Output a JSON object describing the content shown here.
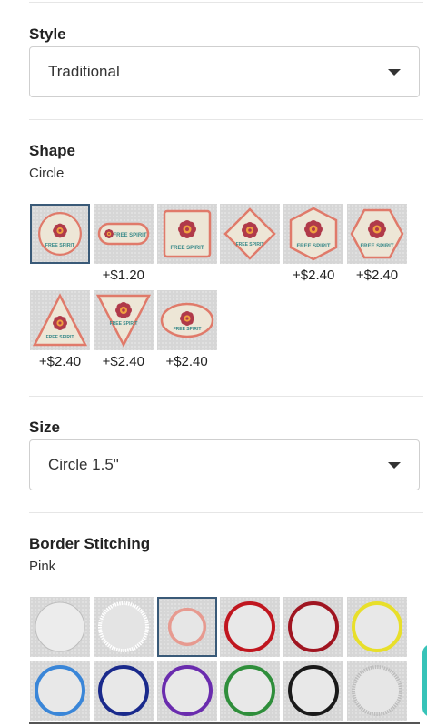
{
  "style": {
    "label": "Style",
    "select_value": "Traditional"
  },
  "shape": {
    "label": "Shape",
    "selected_name": "Circle",
    "options": [
      {
        "name": "circle",
        "price": ""
      },
      {
        "name": "rectangle-pill",
        "price": "+$1.20"
      },
      {
        "name": "square",
        "price": ""
      },
      {
        "name": "diamond",
        "price": ""
      },
      {
        "name": "hexagon-flat",
        "price": "+$2.40"
      },
      {
        "name": "hexagon-pointy",
        "price": "+$2.40"
      },
      {
        "name": "triangle-up",
        "price": "+$2.40"
      },
      {
        "name": "triangle-down",
        "price": "+$2.40"
      },
      {
        "name": "oval",
        "price": "+$2.40"
      }
    ]
  },
  "size": {
    "label": "Size",
    "select_value": "Circle 1.5\""
  },
  "border_stitching": {
    "label": "Border Stitching",
    "selected_name": "Pink",
    "colors": [
      {
        "name": "none-light",
        "hex": "#ececec"
      },
      {
        "name": "white",
        "hex": "#f5f5f5"
      },
      {
        "name": "pink",
        "hex": "#e79a90"
      },
      {
        "name": "red",
        "hex": "#c0161f"
      },
      {
        "name": "maroon",
        "hex": "#a01521"
      },
      {
        "name": "yellow",
        "hex": "#e8df2a"
      },
      {
        "name": "light-blue",
        "hex": "#3a86d8"
      },
      {
        "name": "navy",
        "hex": "#1a2a8c"
      },
      {
        "name": "purple",
        "hex": "#6a2cae"
      },
      {
        "name": "green",
        "hex": "#2f8e3b"
      },
      {
        "name": "black",
        "hex": "#1a1a1a"
      },
      {
        "name": "silver",
        "hex": "#cfcfcf"
      }
    ]
  },
  "colors": {
    "patch_fill": "#ede6d6",
    "patch_border": "#e07a6a",
    "flower_outer": "#b03a4a",
    "flower_inner": "#f0a040",
    "text_teal": "#3a8a8a",
    "selected_border": "#3a5a78"
  }
}
